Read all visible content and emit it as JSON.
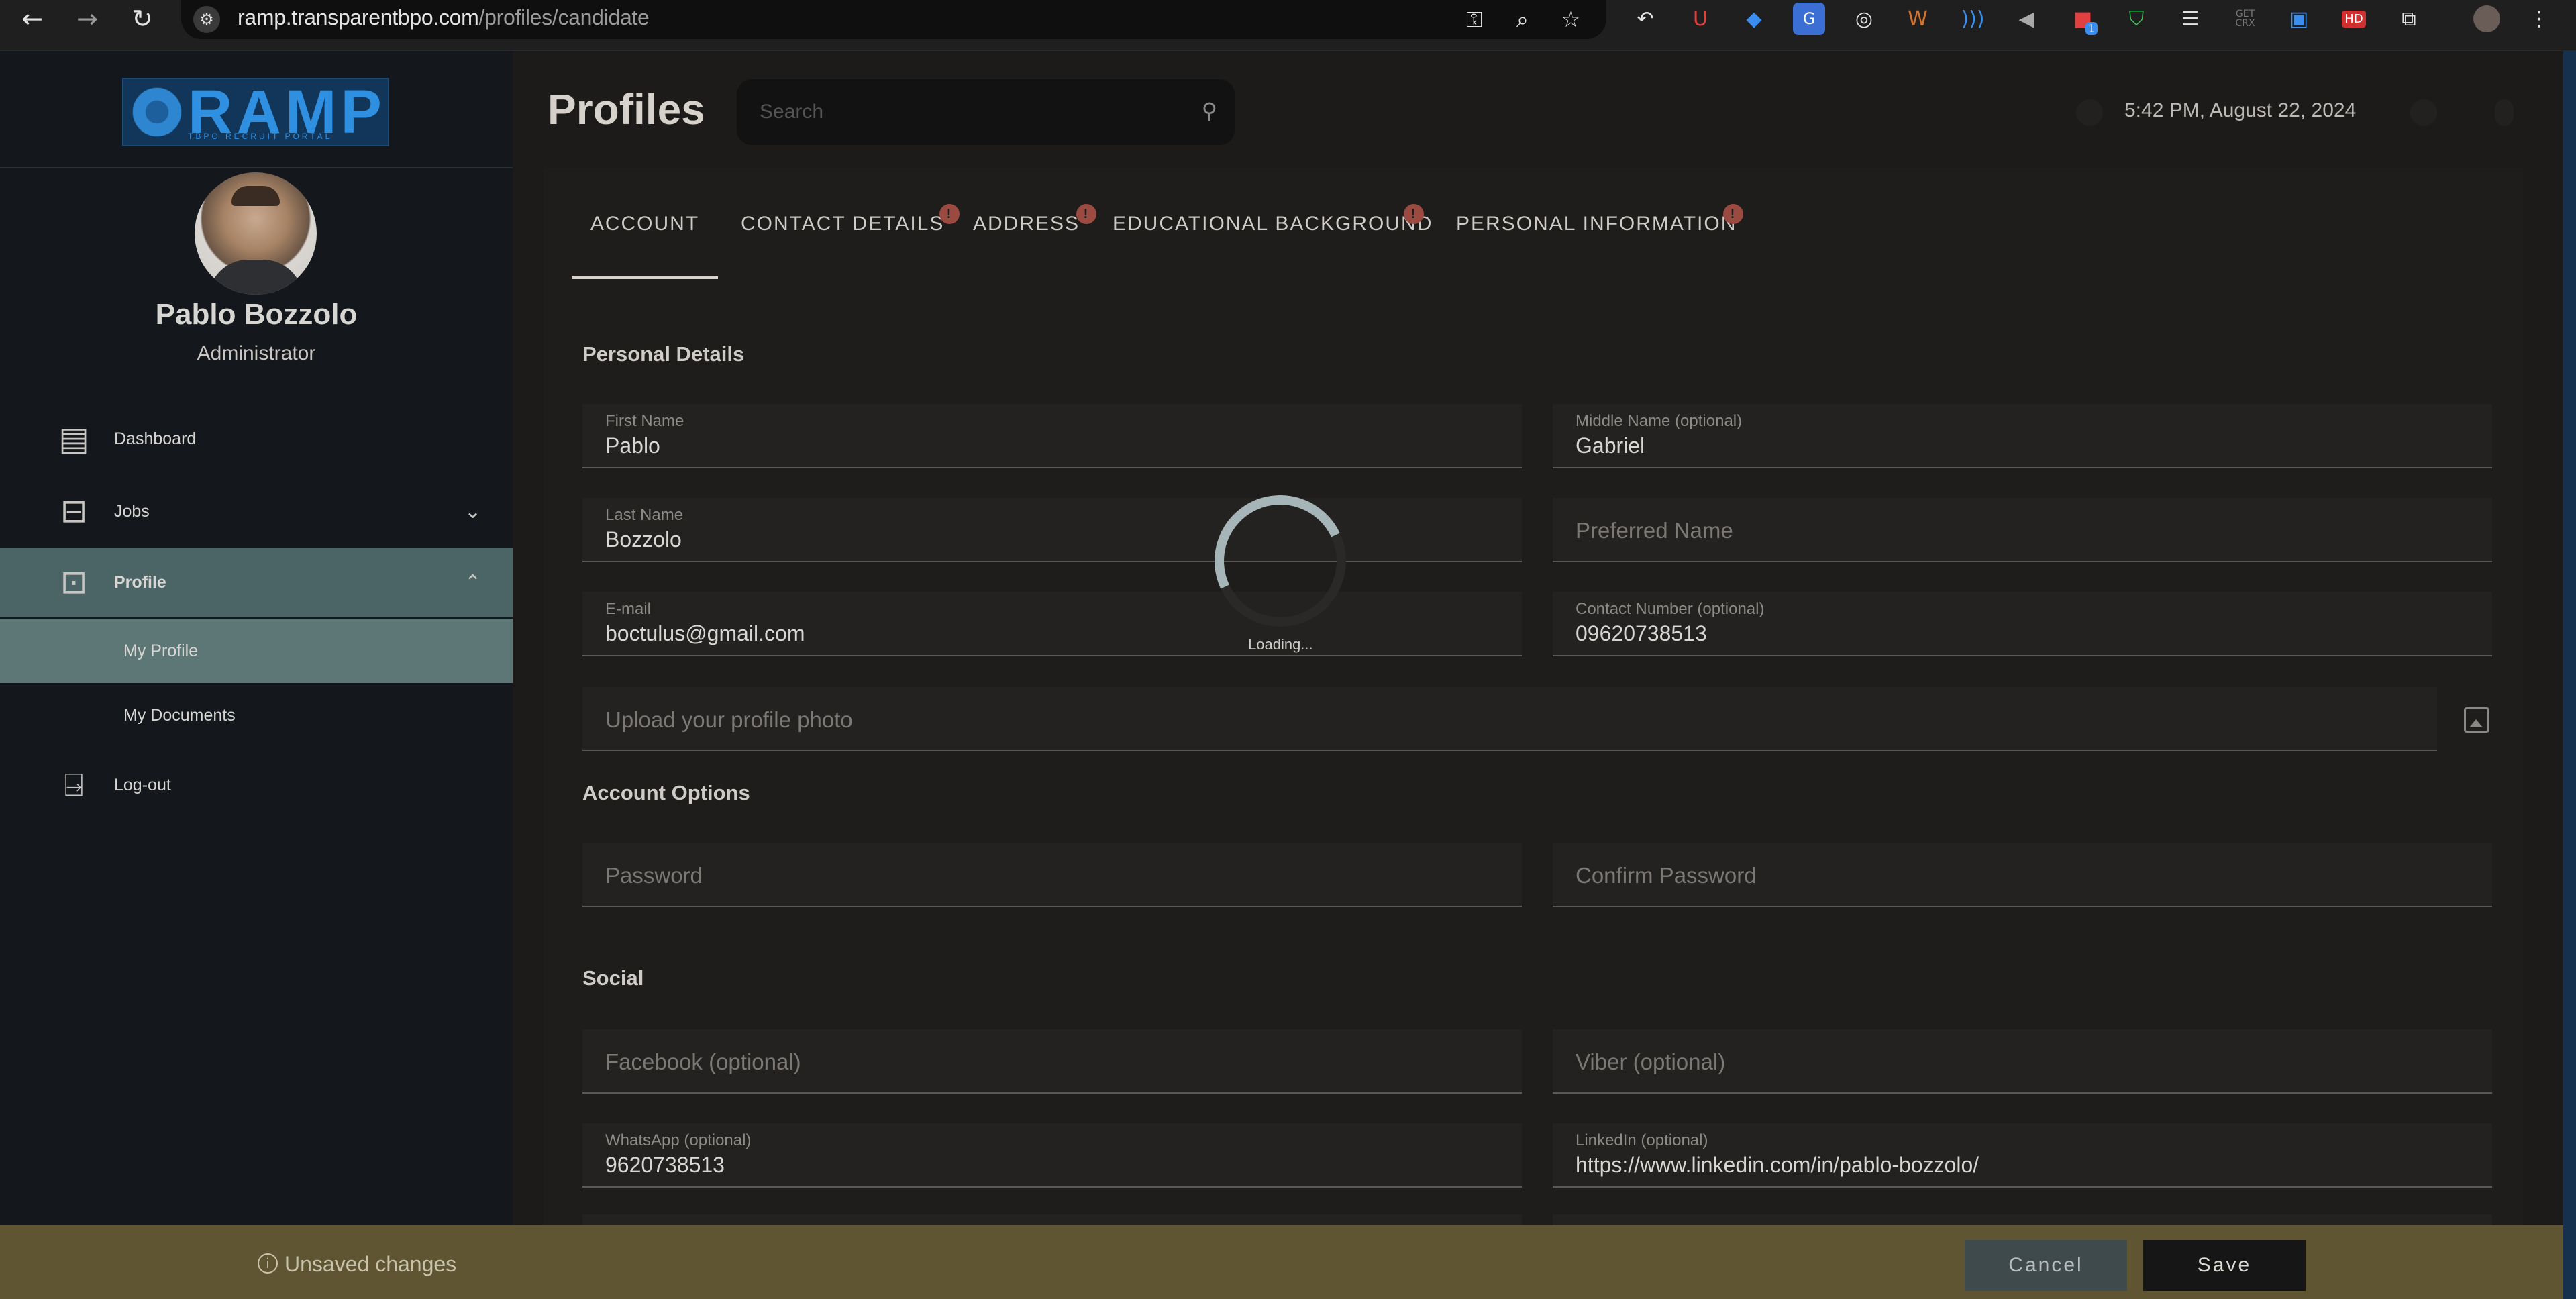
{
  "browser": {
    "url_host": "ramp.transparentbpo.com",
    "url_path": "/profiles/candidate",
    "back_icon": "arrow-left",
    "forward_icon": "arrow-right",
    "reload_icon": "reload",
    "ext_badge": "1",
    "ext_get_crx": "GET CRX",
    "ext_hd": "HD"
  },
  "sidebar": {
    "logo_text": "RAMP",
    "logo_subtitle": "TBPO RECRUIT PORTAL",
    "user_name": "Pablo Bozzolo",
    "user_role": "Administrator",
    "items": [
      {
        "label": "Dashboard",
        "icon": "dashboard-icon"
      },
      {
        "label": "Jobs",
        "icon": "briefcase-icon",
        "chevron": "down"
      },
      {
        "label": "Profile",
        "icon": "profile-card-icon",
        "chevron": "up",
        "active": true
      },
      {
        "label": "Log-out",
        "icon": "logout-door-icon"
      }
    ],
    "sub_items": [
      {
        "label": "My Profile",
        "active": true
      },
      {
        "label": "My Documents"
      }
    ]
  },
  "header": {
    "title": "Profiles",
    "search_placeholder": "Search",
    "datetime": "5:42 PM, August 22, 2024"
  },
  "tabs": [
    {
      "label": "ACCOUNT",
      "active": true
    },
    {
      "label": "CONTACT DETAILS",
      "warning": "!"
    },
    {
      "label": "ADDRESS",
      "warning": "!"
    },
    {
      "label": "EDUCATIONAL BACKGROUND",
      "warning": "!"
    },
    {
      "label": "PERSONAL INFORMATION",
      "warning": "!"
    }
  ],
  "sections": {
    "personal": "Personal Details",
    "account_options": "Account Options",
    "social": "Social"
  },
  "fields": {
    "first_name": {
      "label": "First Name",
      "value": "Pablo"
    },
    "middle_name": {
      "label": "Middle Name (optional)",
      "value": "Gabriel"
    },
    "last_name": {
      "label": "Last Name",
      "value": "Bozzolo"
    },
    "preferred_name": {
      "placeholder": "Preferred Name"
    },
    "email": {
      "label": "E-mail",
      "value": "boctulus@gmail.com"
    },
    "contact_number": {
      "label": "Contact Number (optional)",
      "value": "09620738513"
    },
    "profile_photo": {
      "placeholder": "Upload your profile photo"
    },
    "password": {
      "placeholder": "Password"
    },
    "confirm_password": {
      "placeholder": "Confirm Password"
    },
    "facebook": {
      "placeholder": "Facebook (optional)"
    },
    "viber": {
      "placeholder": "Viber (optional)"
    },
    "whatsapp": {
      "label": "WhatsApp (optional)",
      "value": "9620738513"
    },
    "linkedin": {
      "label": "LinkedIn (optional)",
      "value": "https://www.linkedin.com/in/pablo-bozzolo/"
    }
  },
  "loading": {
    "text": "Loading..."
  },
  "footer": {
    "unsaved": "Unsaved changes",
    "cancel": "Cancel",
    "save": "Save"
  },
  "colors": {
    "sidebar_bg": "#14181d",
    "active_menu": "#4b6466",
    "active_sub": "#5c7776",
    "footer_bg": "#5f5532",
    "warning_badge": "#9a4a40"
  }
}
